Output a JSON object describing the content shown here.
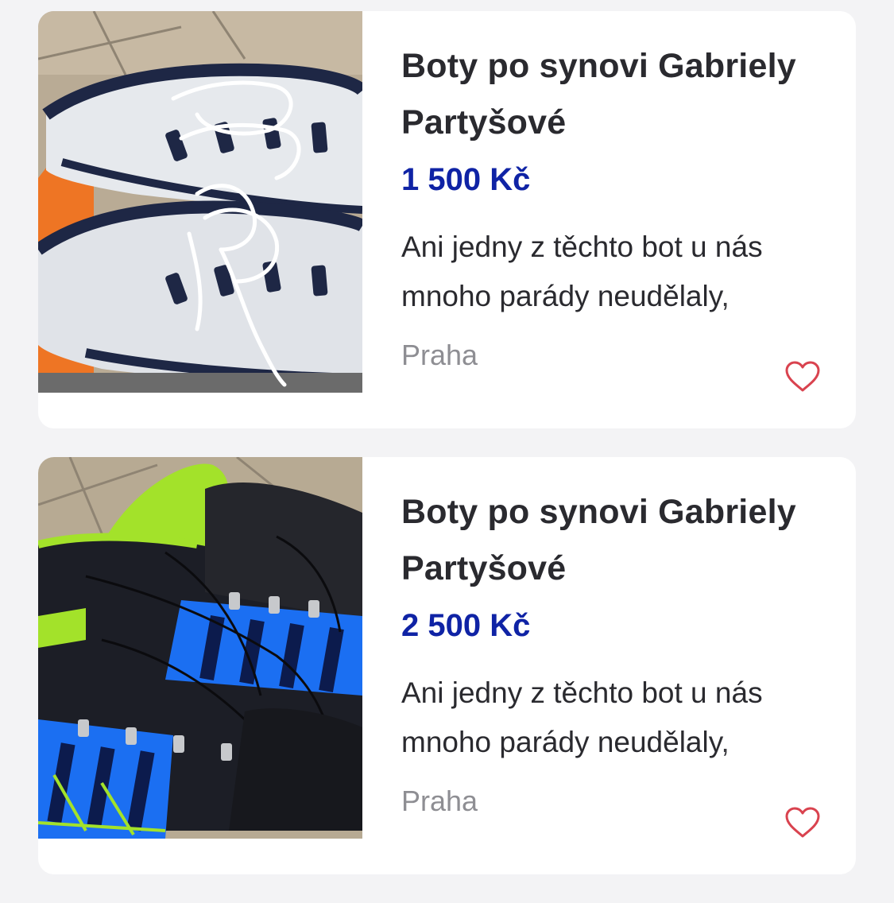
{
  "listings": [
    {
      "title": "Boty po synovi Gabriely Partyšové",
      "price": "1 500 Kč",
      "description": "Ani jedny z těchto bot u nás mnoho parády neudělaly,",
      "location": "Praha",
      "favorite_icon": "heart-outline-icon",
      "image_subject": "white-navy-sneakers"
    },
    {
      "title": "Boty po synovi Gabriely Partyšové",
      "price": "2 500 Kč",
      "description": "Ani jedny z těchto bot u nás mnoho parády neudělaly,",
      "location": "Praha",
      "favorite_icon": "heart-outline-icon",
      "image_subject": "black-blue-lime-sneakers"
    }
  ],
  "colors": {
    "price": "#0f23a5",
    "heart": "#d9434f",
    "location": "#8e8e93",
    "background": "#f3f3f5"
  }
}
